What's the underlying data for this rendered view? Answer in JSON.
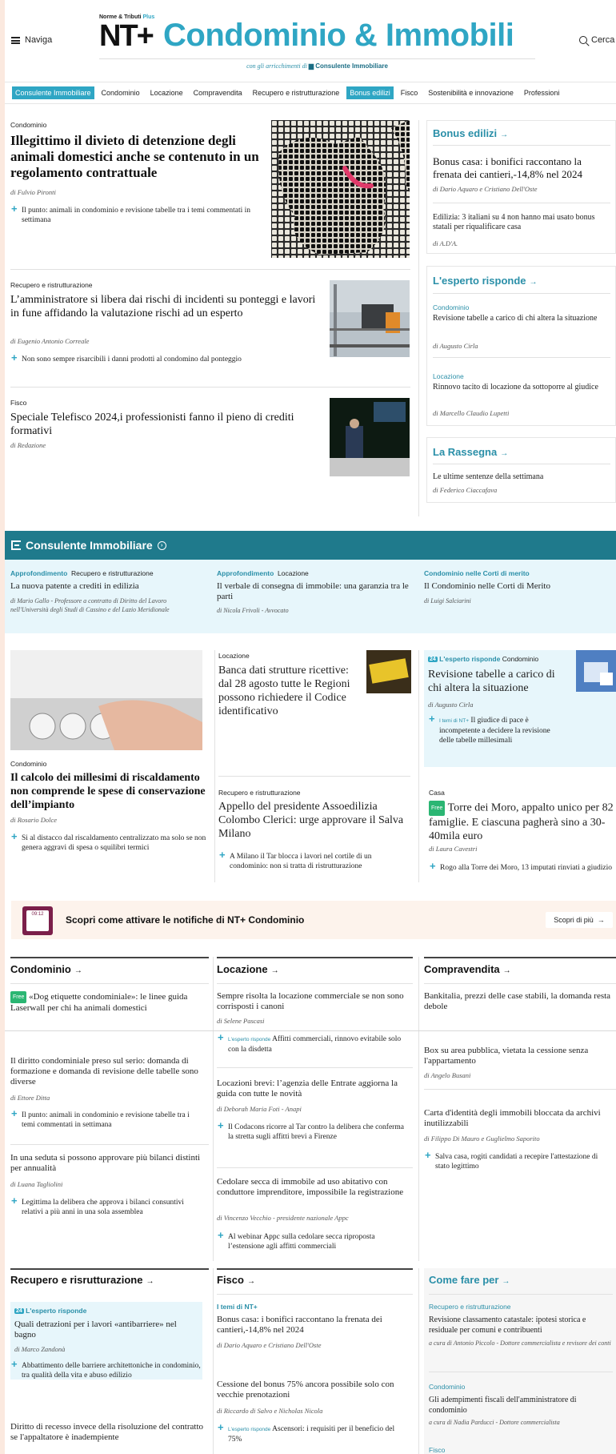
{
  "header": {
    "nav_label": "Naviga",
    "search_label": "Cerca",
    "logo_kicker_a": "Norme & Tributi ",
    "logo_kicker_b": "Plus",
    "logo_nt": "NT+",
    "logo_title": "Condominio & Immobili",
    "logo_sub": "con gli arricchimenti di",
    "logo_sub_brand": "Consulente Immobiliare"
  },
  "topics": [
    {
      "label": "Consulente Immobiliare",
      "highlight": true
    },
    {
      "label": "Condominio",
      "highlight": false
    },
    {
      "label": "Locazione",
      "highlight": false
    },
    {
      "label": "Compravendita",
      "highlight": false
    },
    {
      "label": "Recupero e ristrutturazione",
      "highlight": false
    },
    {
      "label": "Bonus edilizi",
      "highlight": true
    },
    {
      "label": "Fisco",
      "highlight": false
    },
    {
      "label": "Sostenibilità e innovazione",
      "highlight": false
    },
    {
      "label": "Professioni",
      "highlight": false
    }
  ],
  "main": {
    "a1": {
      "kicker": "Condominio",
      "title": "Illegittimo il divieto di detenzione degli animali domestici anche se contenuto in un regolamento contrattuale",
      "author": "di Fulvio Pironti",
      "related": "Il punto: animali in condominio e revisione tabelle tra i temi commentati in settimana"
    },
    "a2": {
      "kicker": "Recupero e ristrutturazione",
      "title": "L’amministratore si libera dai rischi di incidenti su ponteggi e lavori in fune affidando la valutazione rischi ad un esperto",
      "author": "di Eugenio Antonio Correale",
      "related": "Non sono sempre risarcibili i danni prodotti al condomino dal ponteggio"
    },
    "a3": {
      "kicker": "Fisco",
      "title": "Speciale Telefisco 2024,i professionisti fanno il pieno di crediti formativi",
      "author": "di Redazione"
    }
  },
  "sidebar": {
    "bonus": {
      "heading": "Bonus edilizi",
      "t1": "Bonus casa: i bonifici raccontano la frenata dei cantieri,-14,8% nel 2024",
      "a1": "di Dario Aquaro e Cristiano Dell'Oste",
      "t2": "Edilizia: 3 italiani su 4 non hanno mai usato bonus statali per riqualificare casa",
      "a2": "di A.D'A."
    },
    "esperto": {
      "heading": "L'esperto risponde",
      "k1": "Condominio",
      "t1": "Revisione tabelle a carico di chi altera la situazione",
      "a1": "di Augusto Cirla",
      "k2": "Locazione",
      "t2": "Rinnovo tacito di locazione da sottoporre al giudice",
      "a2": "di Marcello Claudio Lupetti"
    },
    "rassegna": {
      "heading": "La Rassegna",
      "t1": "Le ultime sentenze della settimana",
      "a1": "di Federico Ciaccafava"
    }
  },
  "consulente": {
    "band_title": "Consulente Immobiliare",
    "items": [
      {
        "tag": "Approfondimento",
        "sub": "Recupero e ristrutturazione",
        "title": "La nuova patente a crediti in edilizia",
        "author": "di Mario Gallo - Professore a contratto di Diritto del Lavoro nell'Università degli Studi di Cassino e del Lazio Meridionale"
      },
      {
        "tag": "Approfondimento",
        "sub": "Locazione",
        "title": "Il verbale di consegna di immobile: una garanzia tra le parti",
        "author": "di Nicola Frivoli - Avvocato"
      },
      {
        "tag": "Condominio nelle Corti di merito",
        "sub": "",
        "title": "Il Condominio nelle Corti di Merito",
        "author": "di Luigi Salciarini"
      }
    ]
  },
  "block2": {
    "b1": {
      "kicker": "Condominio",
      "title": "Il calcolo dei millesimi di riscaldamento non comprende le spese di conservazione dell’impianto",
      "author": "di Rosario Dolce",
      "related": "Si al distacco dal riscaldamento centralizzato ma solo se non genera aggravi di spesa o squilibri termici"
    },
    "b2": {
      "kicker": "Locazione",
      "title": "Banca dati strutture ricettive: dal 28 agosto tutte le Regioni possono richiedere il Codice identificativo"
    },
    "b3": {
      "badge": "24",
      "tag": "L'esperto risponde",
      "sub": "Condominio",
      "title": "Revisione tabelle a carico di chi altera la situazione",
      "author": "di Augusto Cirla",
      "rel_tag": "I temi di NT+",
      "related": "Il giudice di pace è incompetente a decidere la revisione delle tabelle millesimali"
    },
    "b4": {
      "kicker": "Recupero e ristrutturazione",
      "title": "Appello del presidente Assoedilizia Colombo Clerici: urge approvare il Salva Milano",
      "related": "A Milano il Tar blocca i lavori nel cortile di un condominio: non si tratta di ristrutturazione"
    },
    "b5": {
      "kicker": "Casa",
      "badge": "Free",
      "title": "Torre dei Moro, appalto unico per 82 famiglie. E ciascuna pagherà sino a 30-40mila euro",
      "author": "di Laura Cavestri",
      "related": "Rogo alla Torre dei Moro, 13 imputati rinviati a giudizio"
    }
  },
  "notif": {
    "phone_time": "09:12",
    "text": "Scopri come attivare le notifiche di NT+ Condominio",
    "button": "Scopri di più"
  },
  "cols": {
    "condominio": {
      "heading": "Condominio",
      "i1_badge": "Free",
      "i1": "«Dog etiquette condominiale»: le linee guida Laserwall per chi ha animali domestici",
      "i2": "Il diritto condominiale preso sul serio: domanda di formazione e domanda di revisione delle tabelle sono diverse",
      "i2_author": "di Ettore Ditta",
      "i2_rel": "Il punto: animali in condominio e revisione tabelle tra i temi commentati in settimana",
      "i3": "In una seduta si possono approvare più bilanci distinti per annualità",
      "i3_author": "di Luana Tagliolini",
      "i3_rel": "Legittima la delibera che approva i bilanci consuntivi relativi a più anni in una sola assemblea"
    },
    "locazione": {
      "heading": "Locazione",
      "i1": "Sempre risolta la locazione commerciale se non sono corrisposti i canoni",
      "i1_author": "di Selene Pascasi",
      "i1_rel_tag": "L'esperto risponde",
      "i1_rel": "Affitti commerciali, rinnovo evitabile solo con la disdetta",
      "i2": "Locazioni brevi: l’agenzia delle Entrate aggiorna la guida con tutte le novità",
      "i2_author": "di Deborah Maria Foti - Anapi",
      "i2_rel": "Il Codacons ricorre al Tar contro la delibera che conferma la stretta sugli affitti brevi a Firenze",
      "i3": "Cedolare secca di immobile ad uso abitativo con conduttore imprenditore, impossibile la registrazione",
      "i3_author": "di Vincenzo Vecchio - presidente nazionale Appc",
      "i3_rel": "Al webinar Appc sulla cedolare secca riproposta l’estensione agli affitti commerciali"
    },
    "compravendita": {
      "heading": "Compravendita",
      "i1": "Bankitalia, prezzi delle case stabili, la domanda resta debole",
      "i2": "Box su area pubblica, vietata la cessione senza l'appartamento",
      "i2_author": "di Angelo Busani",
      "i3": "Carta d'identità degli immobili bloccata da archivi inutilizzabili",
      "i3_author": "di Filippo Di Mauro e Guglielmo Saporito",
      "i3_rel": "Salva casa, rogiti candidati a recepire l'attestazione di stato legittimo"
    },
    "recupero": {
      "heading": "Recupero e risrutturazione",
      "badge": "24",
      "tag": "L'esperto risponde",
      "i1": "Quali detrazioni per i lavori «antibarriere» nel bagno",
      "i1_author": "di Marco Zandonà",
      "i1_rel": "Abbattimento delle barriere architettoniche in condominio, tra qualità della vita e abuso edilizio",
      "i2": "Diritto di recesso invece della risoluzione del contratto se l'appaltatore è inadempiente"
    },
    "fisco": {
      "heading": "Fisco",
      "tag": "I temi di NT+",
      "i1": "Bonus casa: i bonifici raccontano la frenata dei cantieri,-14,8% nel 2024",
      "i1_author": "di Dario Aquaro e Cristiano Dell'Oste",
      "i2": "Cessione del bonus 75% ancora possibile solo con vecchie prenotazioni",
      "i2_author": "di Riccardo di Salvo e Nicholas Nicola",
      "i2_rel_tag": "L'esperto risponde",
      "i2_rel": "Ascensori: i requisiti per il beneficio del 75%"
    },
    "comefare": {
      "heading": "Come fare per",
      "k1": "Recupero e ristrutturazione",
      "i1": "Revisione classamento catastale: ipotesi storica e residuale per comuni e contribuenti",
      "i1_author": "a cura di Antonio Piccolo - Dottore commercialista e revisore dei conti",
      "k2": "Condominio",
      "i2": "Gli adempimenti fiscali dell'amministratore di condominio",
      "i2_author": "a cura di Nadia Parducci - Dottore commercialista",
      "k3": "Fisco"
    }
  }
}
